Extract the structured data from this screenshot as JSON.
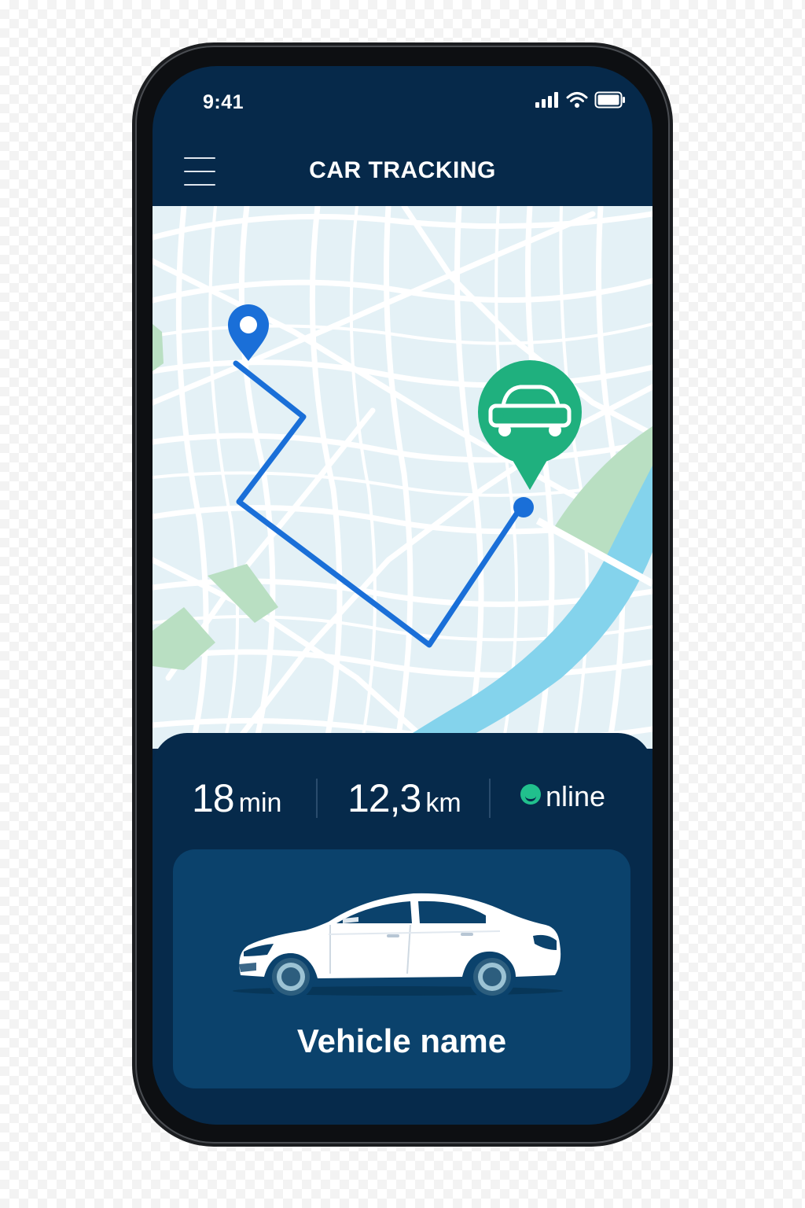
{
  "status_bar": {
    "time": "9:41"
  },
  "header": {
    "title": "CAR TRACKING"
  },
  "stats": {
    "duration_value": "18",
    "duration_unit": "min",
    "distance_value": "12,3",
    "distance_unit": "km",
    "status_label": "nline"
  },
  "vehicle": {
    "name": "Vehicle name"
  },
  "icons": {
    "menu": "hamburger-icon",
    "signal": "cellular-signal-icon",
    "wifi": "wifi-icon",
    "battery": "battery-icon",
    "start_pin": "location-pin-icon",
    "car_pin": "car-marker-icon",
    "vehicle": "sedan-car-icon"
  },
  "colors": {
    "background": "#06294a",
    "route": "#1a6fd8",
    "car_marker": "#1fb07e",
    "online": "#21c08d",
    "map_base": "#e4f1f6",
    "water": "#84d3ec",
    "park": "#b9dfc2"
  }
}
